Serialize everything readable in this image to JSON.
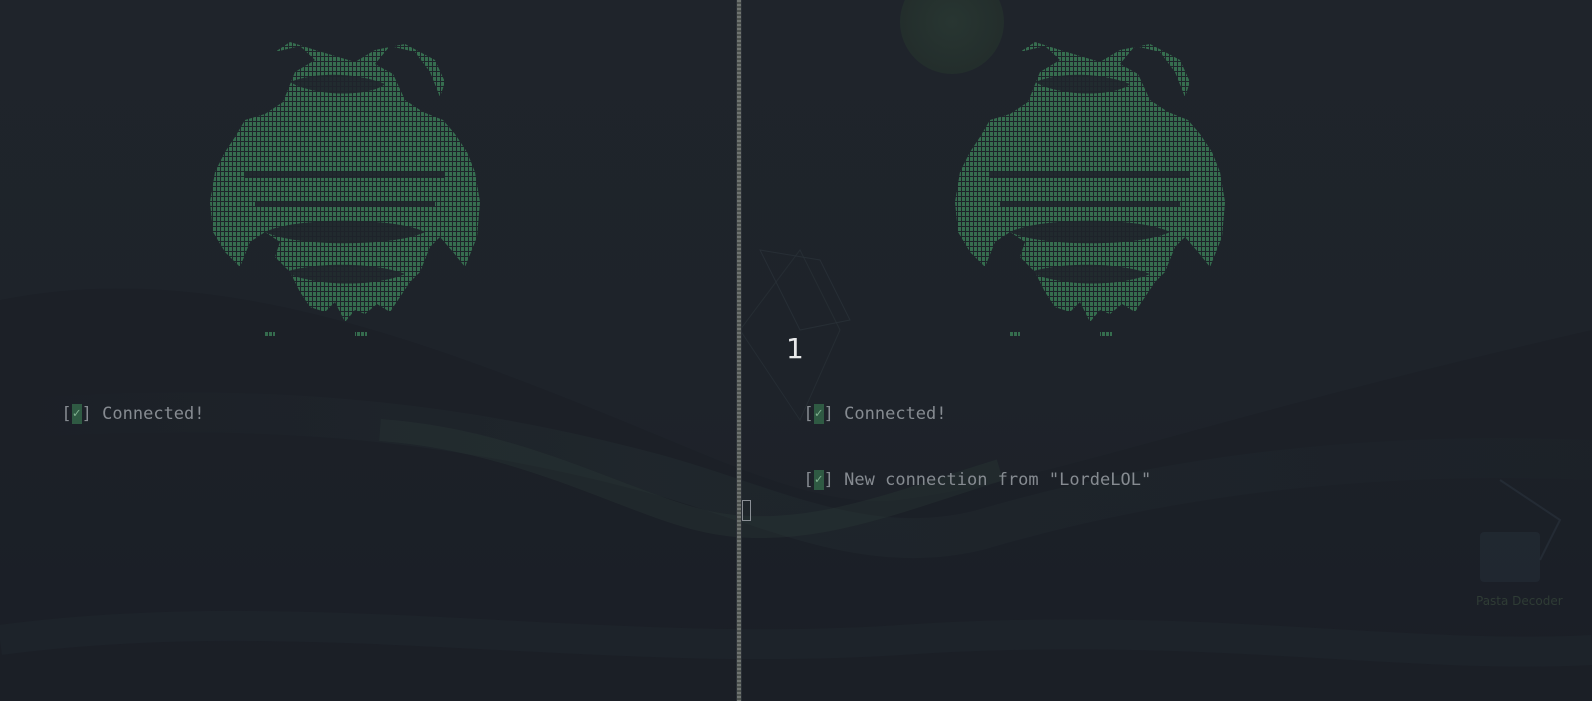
{
  "theme": {
    "background": "#1f232b",
    "text": "#868b91",
    "accent_green": "#2f5a43",
    "emblem_green": "#3a7a55",
    "divider": "#6f7471"
  },
  "workspace": {
    "number": "1"
  },
  "watermark": {
    "text": "Pasta Decoder"
  },
  "left_pane": {
    "emblem_icon": "ascii-art-emblem-icon",
    "lines": [
      {
        "open_bracket": "[",
        "check": "✓",
        "close_bracket": "]",
        "message": " Connected!"
      }
    ]
  },
  "right_pane": {
    "emblem_icon": "ascii-art-emblem-icon",
    "lines": [
      {
        "open_bracket": "[",
        "check": "✓",
        "close_bracket": "]",
        "message": " Connected!"
      },
      {
        "open_bracket": "[",
        "check": "✓",
        "close_bracket": "]",
        "message": " New connection from \"LordeLOL\""
      }
    ]
  }
}
